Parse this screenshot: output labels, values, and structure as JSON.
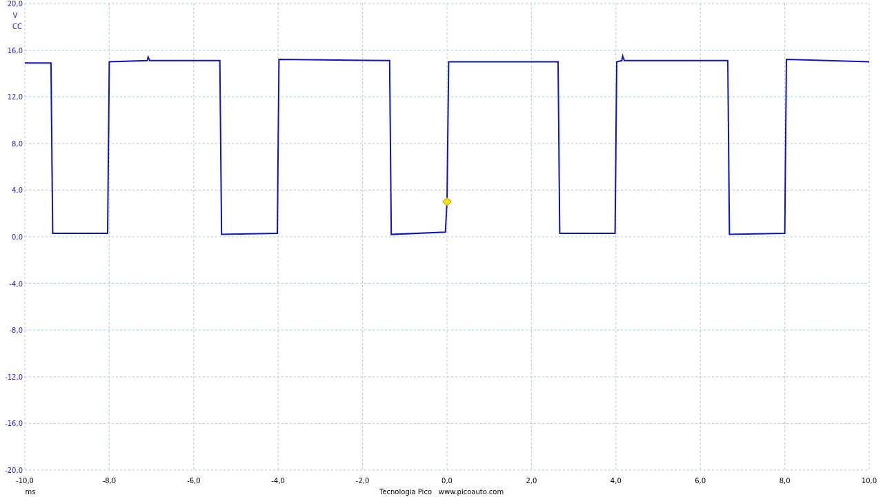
{
  "coupling": "CC",
  "chart_data": {
    "type": "line",
    "xlabel": "ms",
    "ylabel": "V",
    "grid": true,
    "x": [
      -10,
      -9.38,
      -9.34,
      -8.04,
      -8.0,
      -7.1,
      -7.08,
      -7.04,
      -5.38,
      -5.34,
      -4.02,
      -3.98,
      -1.36,
      -1.32,
      -0.04,
      0,
      0.04,
      2.63,
      2.67,
      3.98,
      4.02,
      4.14,
      4.16,
      4.2,
      6.65,
      6.69,
      8.0,
      8.04,
      10
    ],
    "series": [
      {
        "color": "#0a14c8",
        "values": [
          14.9,
          14.9,
          0.3,
          0.3,
          15.0,
          15.1,
          15.4,
          15.1,
          15.1,
          0.2,
          0.3,
          15.2,
          15.1,
          0.2,
          0.4,
          3.0,
          15.0,
          15.0,
          0.3,
          0.3,
          15.0,
          15.1,
          15.5,
          15.1,
          15.1,
          0.2,
          0.3,
          15.2,
          15.0
        ]
      }
    ],
    "xlim": [
      -10,
      10
    ],
    "ylim": [
      -20,
      20
    ],
    "xticks": [
      {
        "value": -10,
        "label": "-10,0"
      },
      {
        "value": -8,
        "label": "-8,0"
      },
      {
        "value": -6,
        "label": "-6,0"
      },
      {
        "value": -4,
        "label": "-4,0"
      },
      {
        "value": -2,
        "label": "-2,0"
      },
      {
        "value": 0,
        "label": "0,0"
      },
      {
        "value": 2,
        "label": "2,0"
      },
      {
        "value": 4,
        "label": "4,0"
      },
      {
        "value": 6,
        "label": "6,0"
      },
      {
        "value": 8,
        "label": "8,0"
      },
      {
        "value": 10,
        "label": "10,0"
      }
    ],
    "yticks": [
      {
        "value": 20,
        "label": "20,0"
      },
      {
        "value": 16,
        "label": "16,0"
      },
      {
        "value": 12,
        "label": "12,0"
      },
      {
        "value": 8,
        "label": "8,0"
      },
      {
        "value": 4,
        "label": "4,0"
      },
      {
        "value": 0,
        "label": "0,0"
      },
      {
        "value": -4,
        "label": "-4,0"
      },
      {
        "value": -8,
        "label": "-8,0"
      },
      {
        "value": -12,
        "label": "-12,0"
      },
      {
        "value": -16,
        "label": "-16,0"
      },
      {
        "value": -20,
        "label": "-20,0"
      }
    ]
  },
  "footer": {
    "company": "Tecnologia Pico",
    "website": "www.picoauto.com"
  }
}
